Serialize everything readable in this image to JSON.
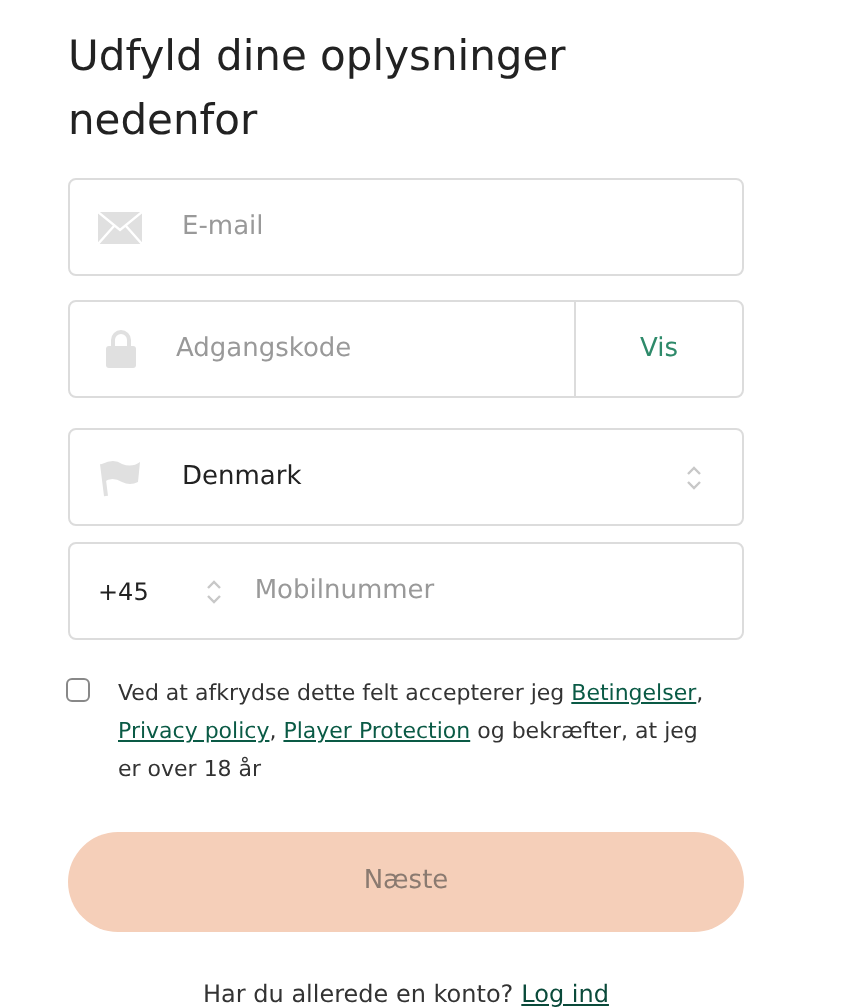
{
  "title": "Udfyld dine oplysninger nedenfor",
  "email": {
    "placeholder": "E-mail"
  },
  "password": {
    "placeholder": "Adgangskode",
    "toggle": "Vis"
  },
  "country": {
    "value": "Denmark"
  },
  "phone": {
    "code": "+45",
    "placeholder": "Mobilnummer"
  },
  "consent": {
    "checked": false,
    "parts": [
      {
        "kind": "text",
        "text": "Ved at afkrydse dette felt accepterer jeg "
      },
      {
        "kind": "link",
        "text": "Betingelser"
      },
      {
        "kind": "text",
        "text": ", "
      },
      {
        "kind": "link",
        "text": "Privacy policy"
      },
      {
        "kind": "text",
        "text": ", "
      },
      {
        "kind": "link",
        "text": "Player Protection"
      },
      {
        "kind": "text",
        "text": " og bekræfter, at jeg er over 18 år"
      }
    ]
  },
  "next_button": {
    "label": "Næste",
    "disabled": true
  },
  "footer": {
    "text": "Har du allerede en konto?",
    "link": "Log ind"
  }
}
